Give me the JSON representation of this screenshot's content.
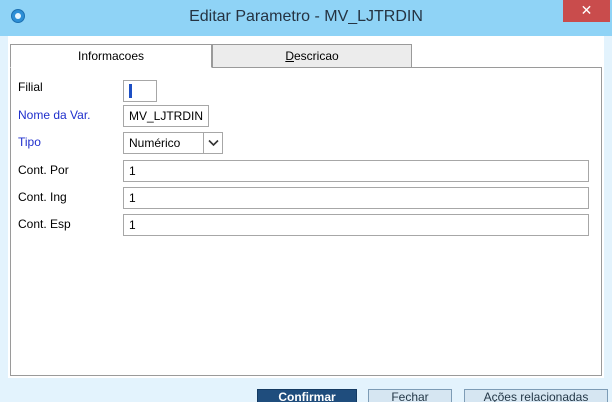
{
  "window": {
    "title": "Editar Parametro - MV_LJTRDIN",
    "close_glyph": "✕"
  },
  "tabs": [
    {
      "label": "Informacoes",
      "active": true
    },
    {
      "label_mnemonic": "D",
      "label_rest": "escricao",
      "active": false
    }
  ],
  "fields": {
    "filial": {
      "label": "Filial",
      "value": ""
    },
    "nome_var": {
      "label": "Nome da Var.",
      "value": "MV_LJTRDIN"
    },
    "tipo": {
      "label": "Tipo",
      "value": "Numérico"
    },
    "cont_por": {
      "label": "Cont. Por",
      "value": "1"
    },
    "cont_ing": {
      "label": "Cont. Ing",
      "value": "1"
    },
    "cont_esp": {
      "label": "Cont. Esp",
      "value": "1"
    }
  },
  "buttons": {
    "confirmar": "Confirmar",
    "fechar": "Fechar",
    "acoes": "Ações relacionadas"
  },
  "colors": {
    "titlebar": "#8fd3f6",
    "close": "#c94c4c",
    "label_blue": "#1f2fcc",
    "primary_button": "#1f4d7d"
  },
  "icons": [
    "app-icon",
    "close-icon",
    "chevron-down-icon"
  ]
}
